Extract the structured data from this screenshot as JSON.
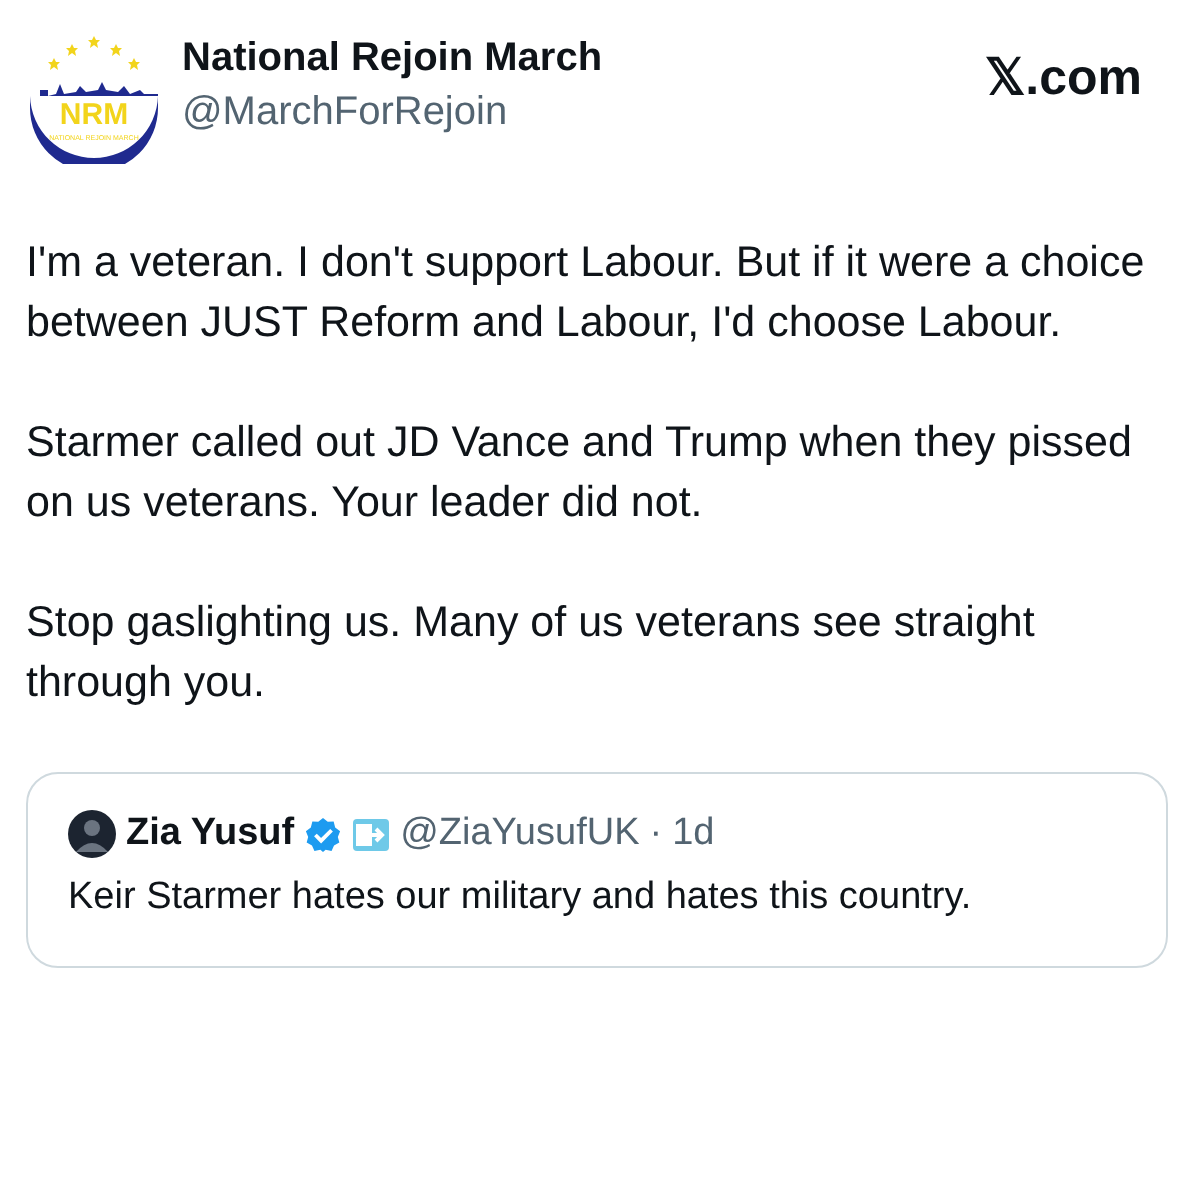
{
  "author": {
    "name": "National Rejoin March",
    "handle": "@MarchForRejoin",
    "logo_text": "NRM",
    "logo_subtext": "NATIONAL REJOIN MARCH"
  },
  "source": "𝕏.com",
  "paragraphs": [
    "I'm a veteran. I don't support Labour. But if it were a choice between JUST Reform and Labour, I'd choose Labour.",
    "Starmer called out JD Vance and Trump when they pissed on us veterans. Your leader did not.",
    "Stop gaslighting us. Many of us veterans see straight through you."
  ],
  "quote": {
    "name": "Zia Yusuf",
    "verified": true,
    "handle": "@ZiaYusufUK",
    "separator": "·",
    "time": "1d",
    "text": "Keir Starmer hates our military and hates this country."
  }
}
